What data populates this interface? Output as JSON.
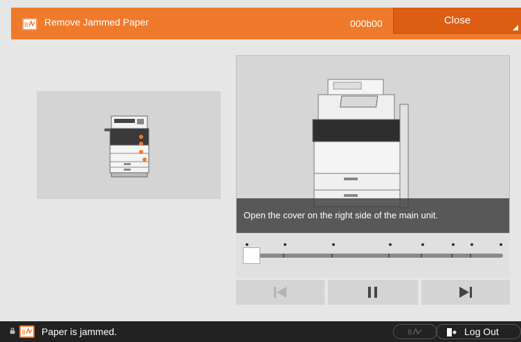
{
  "header": {
    "title": "Remove Jammed Paper",
    "code": "000b00",
    "close_label": "Close"
  },
  "video": {
    "caption": "Open the cover on the right side of the main unit."
  },
  "progress": {
    "position_fraction": 0.0,
    "markers": 9
  },
  "controls": {
    "prev_icon": "skip-previous-icon",
    "pause_icon": "pause-icon",
    "next_icon": "skip-next-icon"
  },
  "status": {
    "message": "Paper is jammed.",
    "logout_label": "Log Out"
  },
  "colors": {
    "accent": "#f07a2b",
    "close_button": "#dd5d12",
    "status_bar": "#222222"
  }
}
